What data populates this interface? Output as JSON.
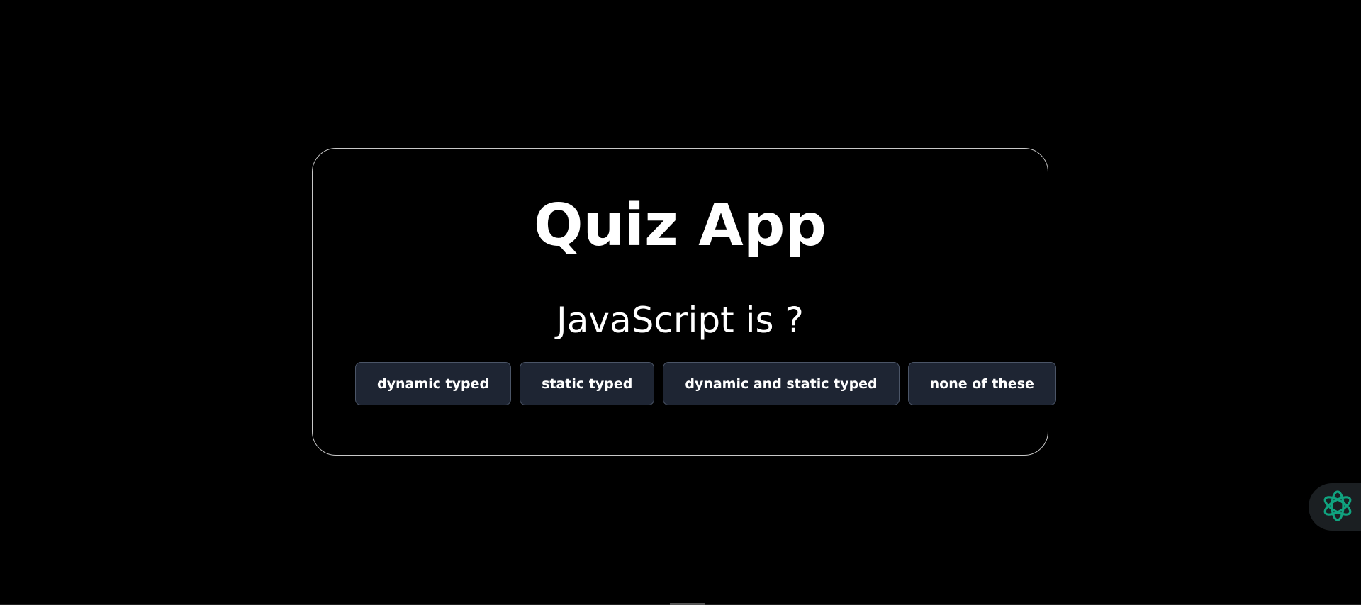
{
  "app": {
    "title": "Quiz App"
  },
  "quiz": {
    "question": "JavaScript is ?",
    "options": [
      {
        "label": "dynamic typed"
      },
      {
        "label": "static typed"
      },
      {
        "label": "dynamic and static typed"
      },
      {
        "label": "none of these"
      }
    ]
  },
  "floating_button": {
    "icon": "ai-assistant-icon"
  },
  "colors": {
    "background": "#000000",
    "card_border": "#c8c8c8",
    "button_background": "#1e2533",
    "button_border": "#4b5567",
    "assistant_icon": "#10a37f"
  }
}
